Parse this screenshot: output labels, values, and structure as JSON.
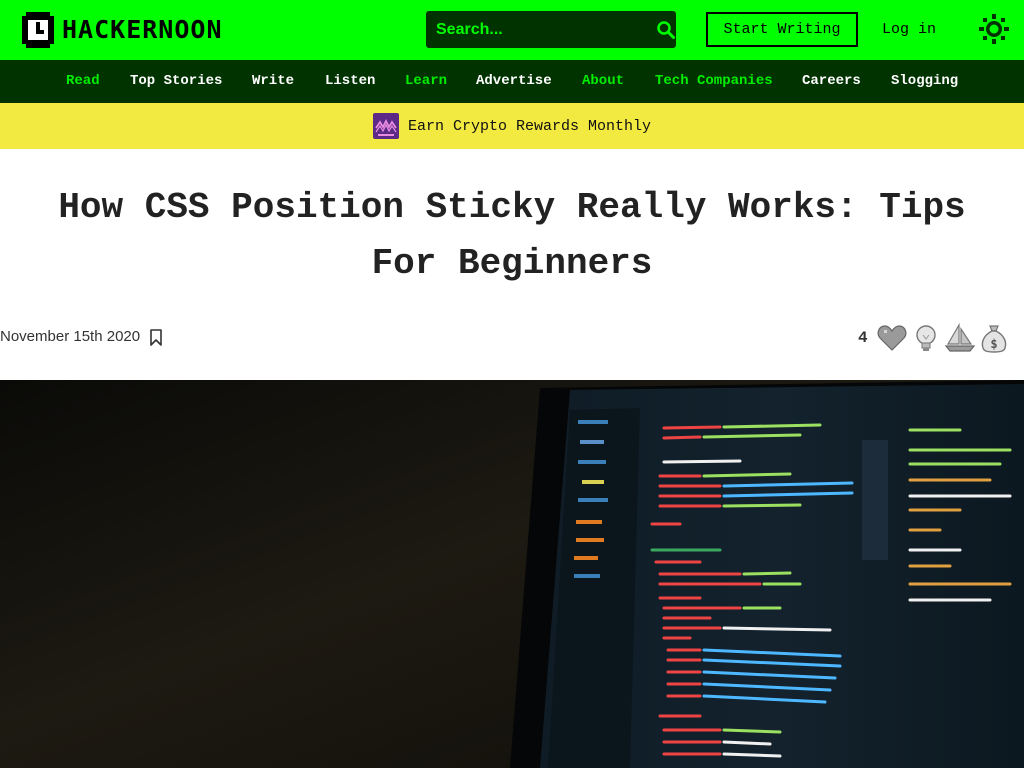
{
  "header": {
    "logo_text": "HACKERNOON",
    "search_placeholder": "Search...",
    "start_writing_label": "Start Writing",
    "login_label": "Log in",
    "brand_color": "#00ff00",
    "dark_green": "#003300"
  },
  "nav": {
    "items": [
      {
        "label": "Read",
        "color": "green"
      },
      {
        "label": "Top Stories",
        "color": "white"
      },
      {
        "label": "Write",
        "color": "white"
      },
      {
        "label": "Listen",
        "color": "white"
      },
      {
        "label": "Learn",
        "color": "green"
      },
      {
        "label": "Advertise",
        "color": "white"
      },
      {
        "label": "About",
        "color": "green"
      },
      {
        "label": "Tech Companies",
        "color": "green"
      },
      {
        "label": "Careers",
        "color": "white"
      },
      {
        "label": "Slogging",
        "color": "white"
      }
    ]
  },
  "promo": {
    "text": "Earn Crypto Rewards Monthly",
    "background": "#f2ea40"
  },
  "article": {
    "title_line1": "How CSS Position Sticky Really Works: Tips",
    "title_line2": "For Beginners",
    "date": "November 15th 2020",
    "reaction_count": "4",
    "reactions": [
      "heart-icon",
      "lightbulb-icon",
      "boat-icon",
      "money-bag-icon"
    ]
  }
}
